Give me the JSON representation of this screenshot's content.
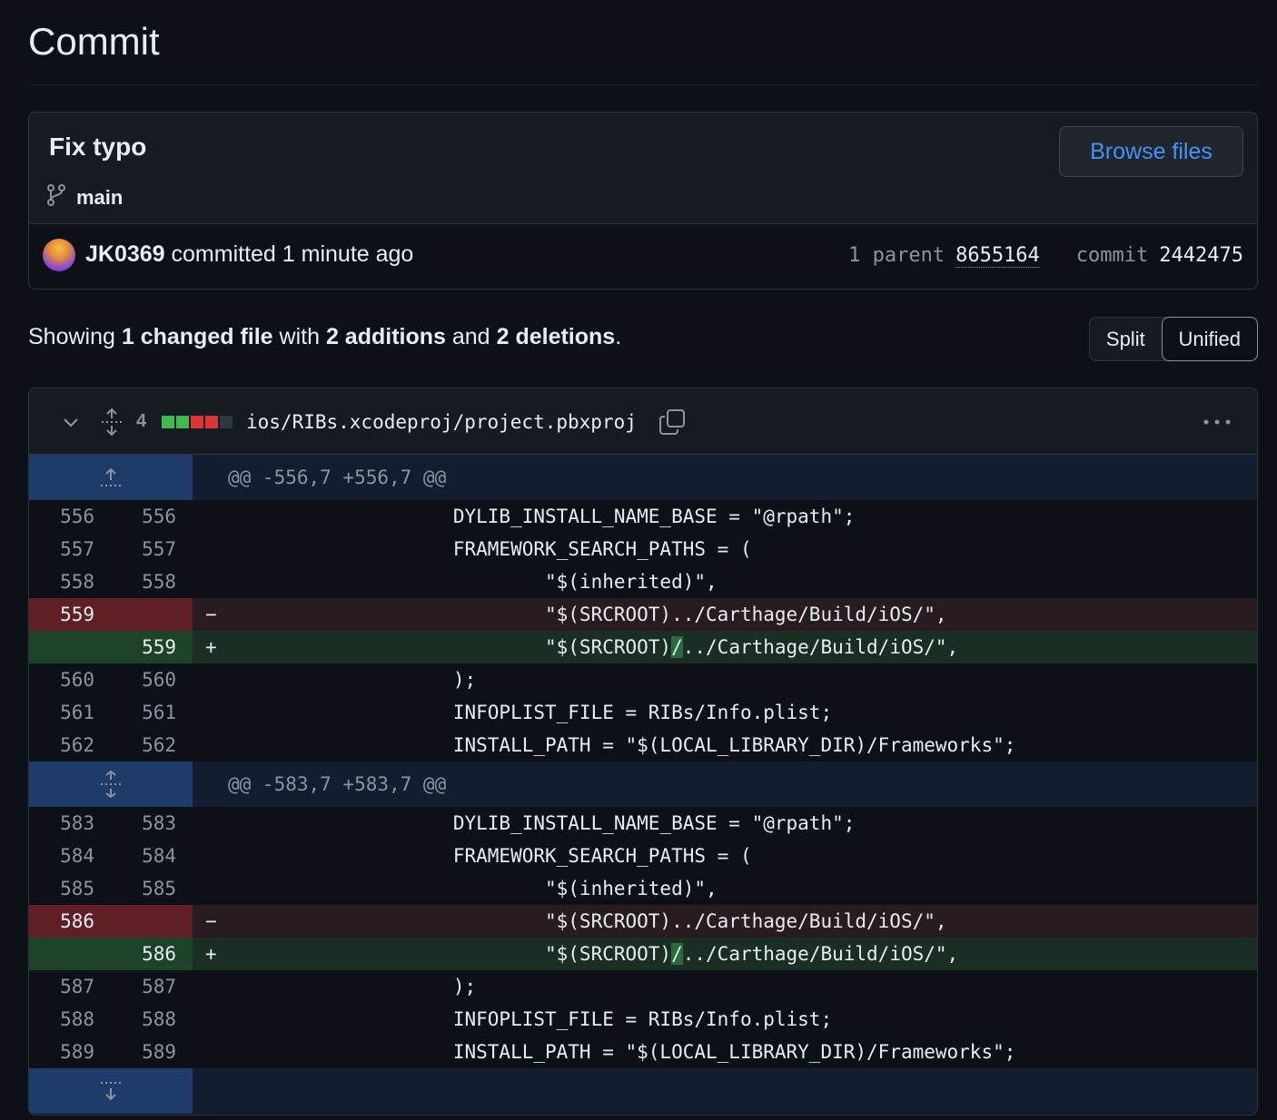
{
  "page": {
    "title": "Commit"
  },
  "commit": {
    "message": "Fix typo",
    "branch": "main",
    "browse_label": "Browse files",
    "author": "JK0369",
    "action": "committed",
    "time": "1 minute ago",
    "parent_label": "1 parent",
    "parent_sha": "8655164",
    "commit_label": "commit",
    "commit_sha": "2442475"
  },
  "stats": {
    "prefix": "Showing",
    "files": "1 changed file",
    "with": "with",
    "additions": "2 additions",
    "and": "and",
    "deletions": "2 deletions",
    "end": "."
  },
  "view_toggle": {
    "split": "Split",
    "unified": "Unified",
    "selected": "Unified"
  },
  "file": {
    "changes": "4",
    "path": "ios/RIBs.xcodeproj/project.pbxproj",
    "diffstat_colors": [
      "#3fb950",
      "#3fb950",
      "#da3633",
      "#da3633",
      "#30363d"
    ],
    "hunks": [
      {
        "header": "@@ -556,7 +556,7 @@",
        "lines": [
          {
            "type": "ctx",
            "old": "556",
            "new": "556",
            "code": "                    DYLIB_INSTALL_NAME_BASE = \"@rpath\";"
          },
          {
            "type": "ctx",
            "old": "557",
            "new": "557",
            "code": "                    FRAMEWORK_SEARCH_PATHS = ("
          },
          {
            "type": "ctx",
            "old": "558",
            "new": "558",
            "code": "                            \"$(inherited)\","
          },
          {
            "type": "del",
            "old": "559",
            "new": "",
            "code": "                            \"$(SRCROOT)../Carthage/Build/iOS/\","
          },
          {
            "type": "add",
            "old": "",
            "new": "559",
            "code_pre": "                            \"$(SRCROOT)",
            "code_hl": "/",
            "code_post": "../Carthage/Build/iOS/\","
          },
          {
            "type": "ctx",
            "old": "560",
            "new": "560",
            "code": "                    );"
          },
          {
            "type": "ctx",
            "old": "561",
            "new": "561",
            "code": "                    INFOPLIST_FILE = RIBs/Info.plist;"
          },
          {
            "type": "ctx",
            "old": "562",
            "new": "562",
            "code": "                    INSTALL_PATH = \"$(LOCAL_LIBRARY_DIR)/Frameworks\";"
          }
        ]
      },
      {
        "header": "@@ -583,7 +583,7 @@",
        "lines": [
          {
            "type": "ctx",
            "old": "583",
            "new": "583",
            "code": "                    DYLIB_INSTALL_NAME_BASE = \"@rpath\";"
          },
          {
            "type": "ctx",
            "old": "584",
            "new": "584",
            "code": "                    FRAMEWORK_SEARCH_PATHS = ("
          },
          {
            "type": "ctx",
            "old": "585",
            "new": "585",
            "code": "                            \"$(inherited)\","
          },
          {
            "type": "del",
            "old": "586",
            "new": "",
            "code": "                            \"$(SRCROOT)../Carthage/Build/iOS/\","
          },
          {
            "type": "add",
            "old": "",
            "new": "586",
            "code_pre": "                            \"$(SRCROOT)",
            "code_hl": "/",
            "code_post": "../Carthage/Build/iOS/\","
          },
          {
            "type": "ctx",
            "old": "587",
            "new": "587",
            "code": "                    );"
          },
          {
            "type": "ctx",
            "old": "588",
            "new": "588",
            "code": "                    INFOPLIST_FILE = RIBs/Info.plist;"
          },
          {
            "type": "ctx",
            "old": "589",
            "new": "589",
            "code": "                    INSTALL_PATH = \"$(LOCAL_LIBRARY_DIR)/Frameworks\";"
          }
        ]
      }
    ]
  },
  "icons": {
    "branch": "git-branch-icon",
    "collapse": "chevron-down-icon",
    "expand_all": "unfold-icon",
    "copy": "copy-icon",
    "more": "kebab-horizontal-icon",
    "expand_up": "fold-up-icon",
    "expand_both": "unfold-icon",
    "expand_down": "fold-down-icon"
  }
}
